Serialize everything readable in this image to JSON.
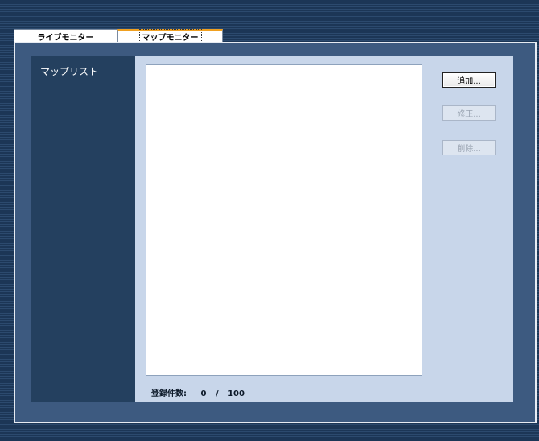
{
  "tabs": {
    "live_monitor": "ライブモニター",
    "map_monitor": "マップモニター"
  },
  "sidebar": {
    "title": "マップリスト"
  },
  "buttons": {
    "add": "追加...",
    "edit": "修正...",
    "delete": "削除..."
  },
  "status": {
    "count_label": "登録件数:",
    "count_current": "0",
    "count_separator": "/",
    "count_max": "100"
  },
  "colors": {
    "background": "#1c3656",
    "panel": "#3d5a80",
    "sidebar": "#24405f",
    "content": "#c8d6ea",
    "active_tab_accent": "#f0a020"
  }
}
